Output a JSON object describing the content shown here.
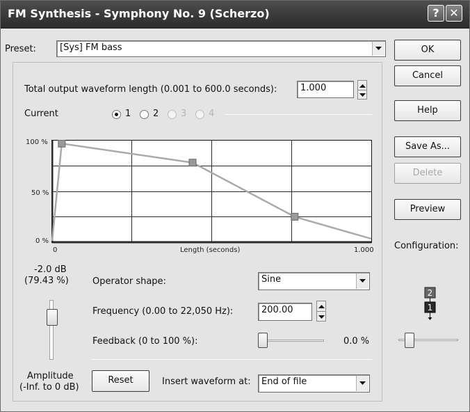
{
  "window": {
    "title": "FM Synthesis - Symphony No. 9 (Scherzo)",
    "help_glyph": "?",
    "close_glyph": "✕"
  },
  "preset": {
    "label": "Preset:",
    "value": "[Sys] FM bass"
  },
  "buttons": {
    "ok": "OK",
    "cancel": "Cancel",
    "help": "Help",
    "save_as": "Save As...",
    "delete": "Delete",
    "preview": "Preview"
  },
  "configuration": {
    "label": "Configuration:",
    "op_top": "2",
    "op_bottom": "1",
    "slider_fraction": 0.12
  },
  "length": {
    "label": "Total output waveform length (0.001 to 600.0 seconds):",
    "value": "1.000"
  },
  "current": {
    "label": "Current",
    "options": [
      "1",
      "2",
      "3",
      "4"
    ],
    "selected": "1"
  },
  "envelope": {
    "y_top": "100 %",
    "y_mid": "50 %",
    "y_bottom": "0 %",
    "x_left": "0",
    "x_label": "Length (seconds)",
    "x_right": "1.000",
    "x_range": [
      0,
      1
    ],
    "y_range": [
      0,
      100
    ],
    "points": [
      [
        0,
        0
      ],
      [
        0.03,
        97
      ],
      [
        0.44,
        78
      ],
      [
        0.76,
        24
      ],
      [
        1.0,
        2
      ]
    ]
  },
  "amplitude": {
    "value_db": "-2.0 dB",
    "value_pct": "(79.43 %)",
    "label": "Amplitude",
    "range": "(-Inf. to 0 dB)",
    "level_fraction": 0.79
  },
  "operator_shape": {
    "label": "Operator shape:",
    "value": "Sine"
  },
  "frequency": {
    "label": "Frequency (0.00 to 22,050 Hz):",
    "value": "200.00"
  },
  "feedback": {
    "label": "Feedback (0 to 100 %):",
    "value": "0.0 %",
    "fraction": 0.0
  },
  "reset": {
    "label": "Reset"
  },
  "insert": {
    "label": "Insert waveform at:",
    "value": "End of file"
  },
  "colors": {
    "title_bar": "#3a3a3a",
    "graph_bg": "#ffffff",
    "envelope_line": "#aaaaaa",
    "handle": "#9a9a9a"
  }
}
